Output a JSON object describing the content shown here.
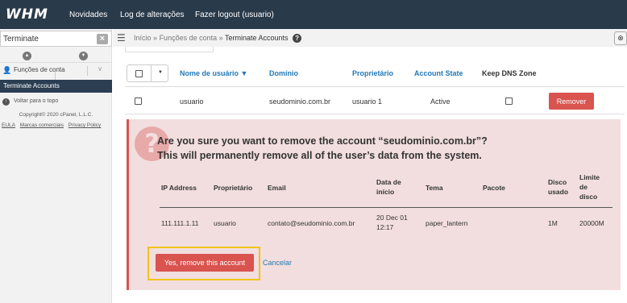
{
  "header": {
    "logo": "WHM",
    "nav": [
      "Novidades",
      "Log de alterações",
      "Fazer logout (usuario)"
    ]
  },
  "sidebar": {
    "search_value": "Terminate",
    "category": "Funções de conta",
    "active_item": "Terminate Accounts",
    "back_to_top": "Voltar para o topo",
    "copyright": "Copyright© 2020 cPanel, L.L.C.",
    "links": [
      "EULA",
      "Marcas comerciais",
      "Privacy Policy"
    ]
  },
  "breadcrumb": {
    "home": "Início",
    "sep": "»",
    "section": "Funções de conta",
    "current": "Terminate Accounts"
  },
  "table": {
    "headers": {
      "username": "Nome de usuário ▼",
      "domain": "Domínio",
      "owner": "Proprietário",
      "state": "Account State",
      "keep_dns": "Keep DNS Zone"
    },
    "row": {
      "username": "usuario",
      "domain": "seudominio.com.br",
      "owner": "usuario 1",
      "state": "Active",
      "remove_label": "Remover"
    }
  },
  "confirm": {
    "line1": "Are you sure you want to remove the account “seudominio.com.br”?",
    "line2": "This will permanently remove all of the user’s data from the system.",
    "headers": {
      "ip": "IP Address",
      "owner": "Proprietário",
      "email": "Email",
      "start_1": "Data de",
      "start_2": "início",
      "theme": "Tema",
      "package": "Pacote",
      "disk_1": "Disco",
      "disk_2": "usado",
      "limit_1": "Limite",
      "limit_2": "de",
      "limit_3": "disco"
    },
    "row": {
      "ip": "111.111.1.11",
      "owner": "usuario",
      "email": "contato@seudominio.com.br",
      "start_1": "20 Dec 01",
      "start_2": "12:17",
      "theme": "paper_lantern",
      "package": "",
      "disk": "1M",
      "limit": "20000M"
    },
    "confirm_label": "Yes, remove this account",
    "cancel_label": "Cancelar"
  },
  "colors": {
    "topbar": "#293a4a",
    "link": "#2478b5",
    "danger": "#d9534f",
    "panel_bg": "#f2dede",
    "highlight": "#f0c419"
  }
}
